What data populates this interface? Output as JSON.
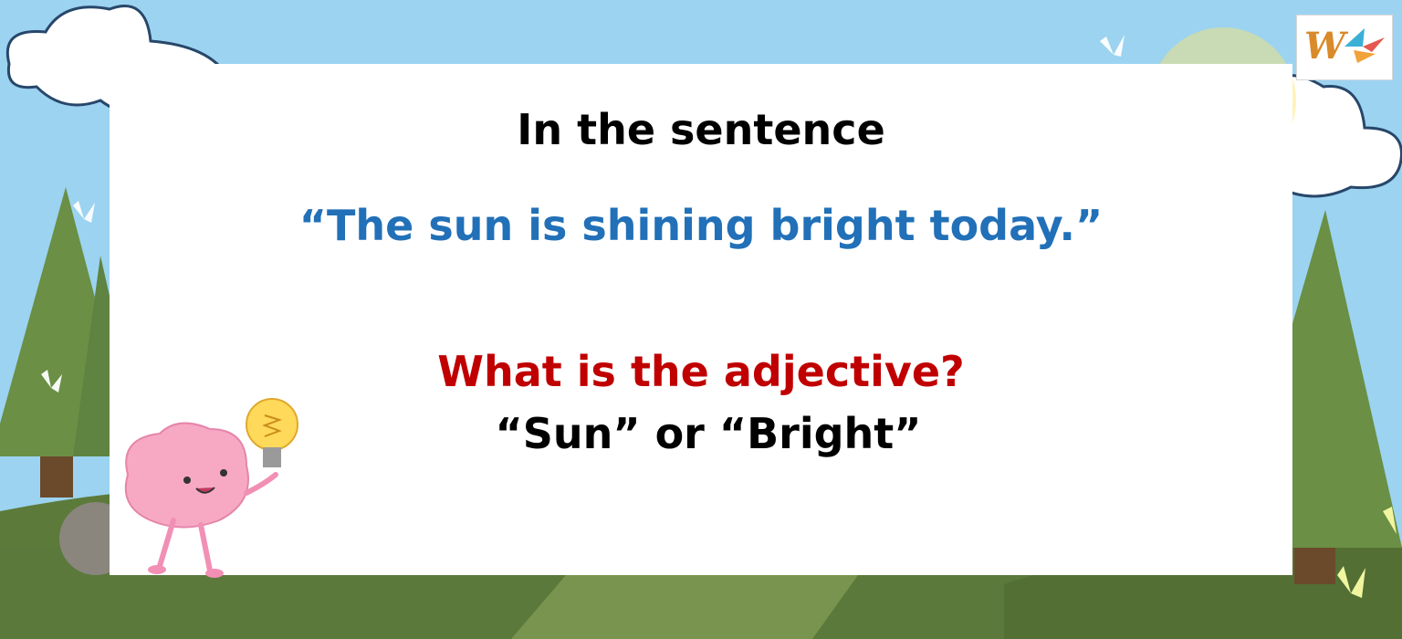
{
  "slide": {
    "line1": "In the sentence",
    "line2": "“The sun is shining bright today.”",
    "line3": "What is the adjective?",
    "line4": "“Sun” or “Bright”"
  },
  "logo": {
    "text": "W"
  },
  "colors": {
    "sky": "#9cd3f0",
    "quote": "#2170b8",
    "question": "#c00000",
    "grass": "#5c7a3a",
    "tree": "#6a8f45"
  },
  "icons": [
    "cloud-icon",
    "sun-icon",
    "tree-icon",
    "butterfly-icon",
    "brain-mascot-icon",
    "lightbulb-icon",
    "rock-icon",
    "logo-icon"
  ]
}
